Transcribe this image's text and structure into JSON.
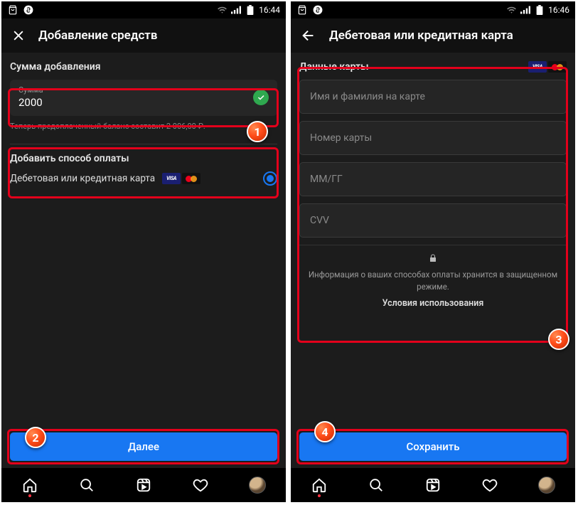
{
  "status": {
    "time": "16:44",
    "time2": "16:46"
  },
  "left": {
    "title": "Добавление средств",
    "amount_section": "Сумма добавления",
    "amount_label": "Сумма",
    "amount_value": "2000",
    "hint": "Теперь предоплаченный баланс составит 2 006,00 ₽.",
    "pay_section": "Добавить способ оплаты",
    "pay_option": "Дебетовая или кредитная карта",
    "visa": "VISA",
    "next": "Далее"
  },
  "right": {
    "title": "Дебетовая или кредитная карта",
    "cf_title": "Данные карты",
    "visa": "VISA",
    "ph_name": "Имя и фамилия на карте",
    "ph_number": "Номер карты",
    "ph_exp": "ММ/ГГ",
    "ph_cvv": "CVV",
    "sec_text": "Информация о ваших способах оплаты хранится в защищенном режиме.",
    "terms": "Условия использования",
    "save": "Сохранить"
  },
  "badges": {
    "b1": "1",
    "b2": "2",
    "b3": "3",
    "b4": "4"
  }
}
